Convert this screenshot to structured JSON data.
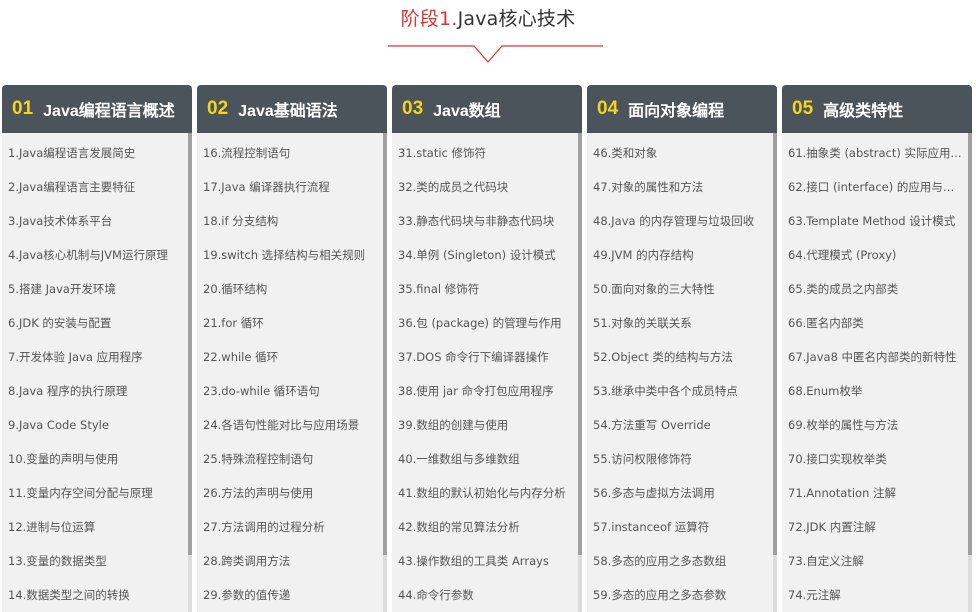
{
  "header": {
    "title_accent": "阶段1.",
    "title_rest": "Java核心技术"
  },
  "colors": {
    "accent": "#e0312d",
    "header_bg": "#4c545b",
    "number": "#f3d41f",
    "column_bg": "#f1f1f1"
  },
  "columns": [
    {
      "num": "01",
      "title": "Java编程语言概述",
      "items": [
        "1.Java编程语言发展简史",
        "2.Java编程语言主要特征",
        "3.Java技术体系平台",
        "4.Java核心机制与JVM运行原理",
        "5.搭建 Java开发环境",
        "6.JDK 的安装与配置",
        "7.开发体验 Java 应用程序",
        "8.Java 程序的执行原理",
        "9.Java Code Style",
        "10.变量的声明与使用",
        "11.变量内存空间分配与原理",
        "12.进制与位运算",
        "13.变量的数据类型",
        "14.数据类型之间的转换"
      ]
    },
    {
      "num": "02",
      "title": "Java基础语法",
      "items": [
        "16.流程控制语句",
        "17.Java 编译器执行流程",
        "18.if 分支结构",
        "19.switch 选择结构与相关规则",
        "20.循环结构",
        "21.for 循环",
        "22.while 循环",
        "23.do-while 循环语句",
        "24.各语句性能对比与应用场景",
        "25.特殊流程控制语句",
        "26.方法的声明与使用",
        "27.方法调用的过程分析",
        "28.跨类调用方法",
        "29.参数的值传递"
      ]
    },
    {
      "num": "03",
      "title": "Java数组",
      "items": [
        "31.static 修饰符",
        "32.类的成员之代码块",
        "33.静态代码块与非静态代码块",
        "34.单例 (Singleton) 设计模式",
        "35.final 修饰符",
        "36.包 (package) 的管理与作用",
        "37.DOS 命令行下编译器操作",
        "38.使用 jar 命令打包应用程序",
        "39.数组的创建与使用",
        "40.一维数组与多维数组",
        "41.数组的默认初始化与内存分析",
        "42.数组的常见算法分析",
        "43.操作数组的工具类 Arrays",
        "44.命令行参数"
      ]
    },
    {
      "num": "04",
      "title": "面向对象编程",
      "items": [
        "46.类和对象",
        "47.对象的属性和方法",
        "48.Java 的内存管理与垃圾回收",
        "49.JVM 的内存结构",
        "50.面向对象的三大特性",
        "51.对象的关联关系",
        "52.Object 类的结构与方法",
        "53.继承中类中各个成员特点",
        "54.方法重写 Override",
        "55.访问权限修饰符",
        "56.多态与虚拟方法调用",
        "57.instanceof 运算符",
        "58.多态的应用之多态数组",
        "59.多态的应用之多态参数"
      ]
    },
    {
      "num": "05",
      "title": "高级类特性",
      "items": [
        "61.抽象类 (abstract) 实际应用...",
        "62.接口 (interface) 的应用与常...",
        "63.Template Method 设计模式",
        "64.代理模式 (Proxy)",
        "65.类的成员之内部类",
        "66.匿名内部类",
        "67.Java8 中匿名内部类的新特性",
        "68.Enum枚举",
        "69.枚举的属性与方法",
        "70.接口实现枚举类",
        "71.Annotation 注解",
        "72.JDK 内置注解",
        "73.自定义注解",
        "74.元注解"
      ]
    }
  ]
}
